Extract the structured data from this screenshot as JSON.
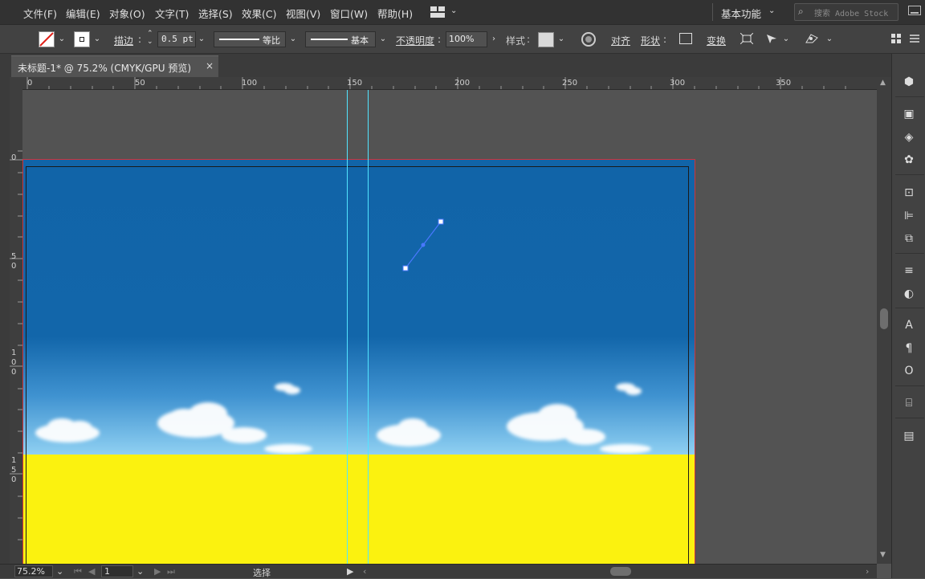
{
  "menu": [
    "文件(F)",
    "编辑(E)",
    "对象(O)",
    "文字(T)",
    "选择(S)",
    "效果(C)",
    "视图(V)",
    "窗口(W)",
    "帮助(H)"
  ],
  "workspace": {
    "label": "基本功能"
  },
  "search": {
    "placeholder": "搜索 Adobe Stock"
  },
  "control": {
    "stroke_label": "描边",
    "stroke_value": "0.5 pt",
    "profile_label": "等比",
    "brush_label": "基本",
    "opacity_label": "不透明度",
    "opacity_value": "100%",
    "style_label": "样式",
    "align_label": "对齐",
    "shape_label": "形状",
    "transform_label": "变换"
  },
  "document": {
    "tab_title": "未标题-1* @ 75.2% (CMYK/GPU 预览)",
    "close_glyph": "×"
  },
  "ruler": {
    "h_labels": [
      "0",
      "50",
      "100",
      "150",
      "200",
      "250",
      "300",
      "350"
    ],
    "v_labels": [
      "0",
      "5\n0",
      "1\n0\n0",
      "1\n5\n0"
    ]
  },
  "status": {
    "zoom": "75.2%",
    "artboard": "1",
    "tool": "选择"
  },
  "colors": {
    "sky_top": "#1164a8",
    "sky_bottom": "#8fd0f2",
    "ground": "#fbf20f",
    "guide": "#52e5ff",
    "artboard_border": "#d0333b",
    "path_color": "#4a78ff"
  }
}
